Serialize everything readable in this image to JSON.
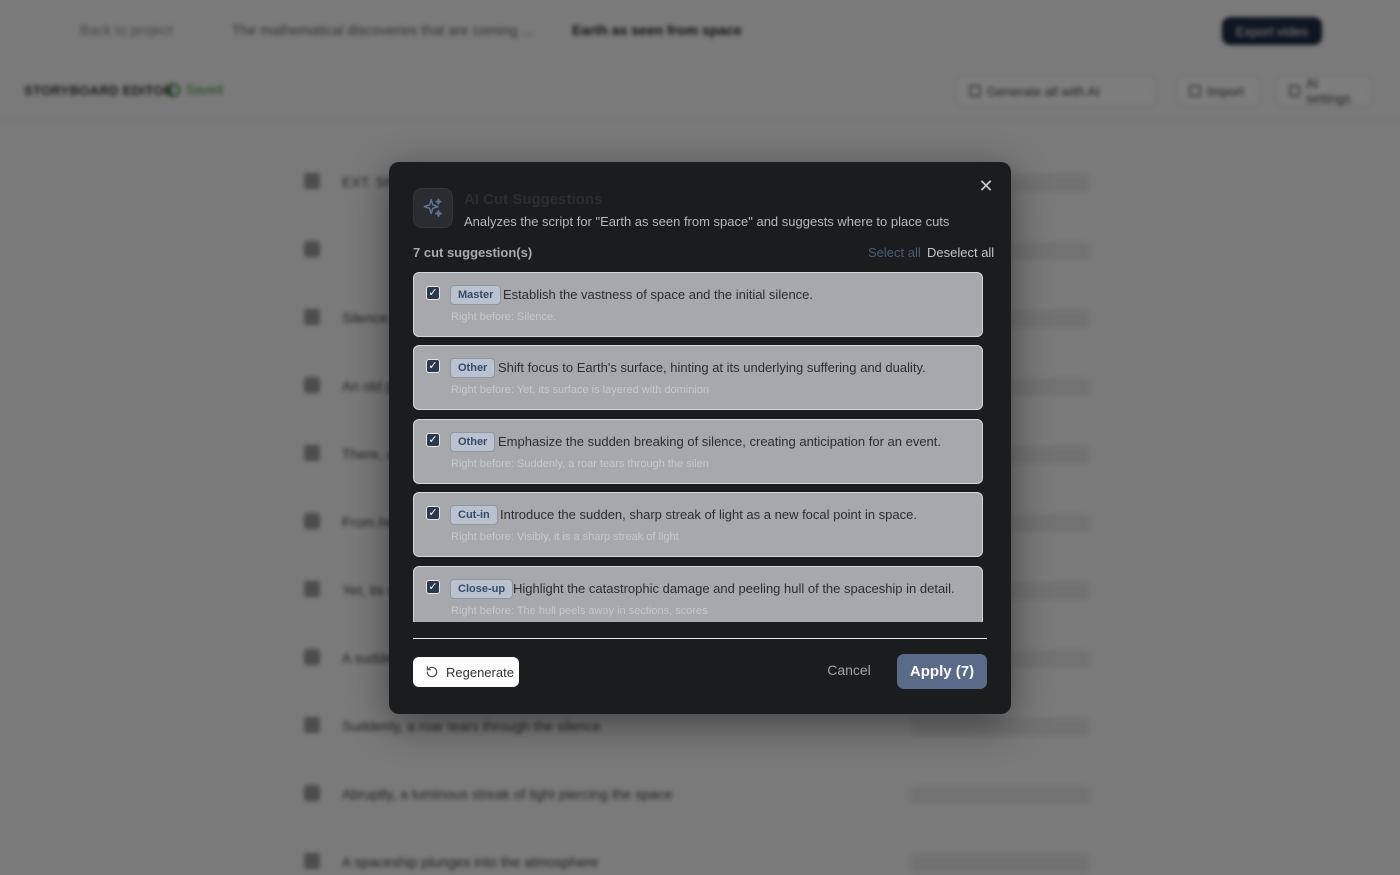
{
  "topbar": {
    "back_label": "Back to project",
    "project_title": "The mathematical discoveries that are coming ...",
    "current_title": "Earth as seen from space",
    "export_label": "Export video"
  },
  "toolbar": {
    "title": "STORYBOARD EDITOR",
    "saved_label": "Saved",
    "generate_label": "Generate all with AI",
    "import_label": "Import",
    "settings_label": "AI settings"
  },
  "background_shots": [
    "EXT. SPACE - NIGHT",
    "",
    "Silence. Space is endless.",
    "An old planet drifts in darkness",
    "There, a city lies in ruins",
    "From here the view is endless",
    "Yet, its surface is layered with dominion",
    "A sudden noise breaks the silence",
    "Suddenly, a roar tears through the silence",
    "Abruptly, a luminous streak of light piercing the space",
    "A spaceship plunges into the atmosphere"
  ],
  "modal": {
    "title": "AI Cut Suggestions",
    "subtitle": "Analyzes the script for \"Earth as seen from space\" and suggests where to place cuts",
    "count_label": "7 cut suggestion(s)",
    "select_all": "Select all",
    "deselect_all": "Deselect all",
    "regenerate_label": "Regenerate",
    "cancel_label": "Cancel",
    "apply_label": "Apply (7)",
    "suggestions": [
      {
        "tag": "Master",
        "description": "Establish the vastness of space and the initial silence.",
        "before": "Right before: Silence.",
        "checked": true
      },
      {
        "tag": "Other",
        "description": "Shift focus to Earth's surface, hinting at its underlying suffering and duality.",
        "before": "Right before: Yet, its surface is layered with dominion",
        "checked": true
      },
      {
        "tag": "Other",
        "description": "Emphasize the sudden breaking of silence, creating anticipation for an event.",
        "before": "Right before: Suddenly, a roar tears through the silen",
        "checked": true
      },
      {
        "tag": "Cut-in",
        "description": "Introduce the sudden, sharp streak of light as a new focal point in space.",
        "before": "Right before: Visibly, it is a sharp streak of light",
        "checked": true
      },
      {
        "tag": "Close-up",
        "description": "Highlight the catastrophic damage and peeling hull of the spaceship in detail.",
        "before": "Right before: The hull peels away in sections, scores",
        "checked": true
      }
    ]
  }
}
